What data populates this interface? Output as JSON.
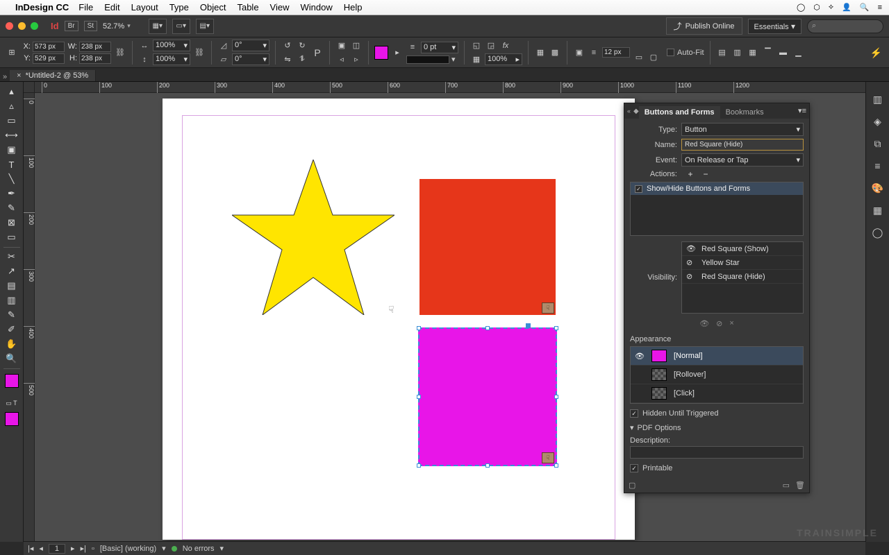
{
  "mac_menu": {
    "app": "InDesign CC",
    "items": [
      "File",
      "Edit",
      "Layout",
      "Type",
      "Object",
      "Table",
      "View",
      "Window",
      "Help"
    ]
  },
  "app_bar": {
    "zoom": "52.7%",
    "publish": "Publish Online",
    "workspace": "Essentials"
  },
  "control": {
    "x": "573 px",
    "y": "529 px",
    "w": "238 px",
    "h": "238 px",
    "scaleX": "100%",
    "scaleY": "100%",
    "rotate": "0°",
    "shear": "0°",
    "stroke": "0 pt",
    "opacity": "100%",
    "gap": "12 px",
    "autofit": "Auto-Fit"
  },
  "doc_tab": "*Untitled-2 @ 53%",
  "ruler_h": [
    0,
    100,
    200,
    300,
    400,
    500,
    600,
    700,
    800,
    900,
    1000,
    1100,
    1200
  ],
  "ruler_v": [
    0,
    100,
    200,
    300,
    400,
    500
  ],
  "panel": {
    "tab_active": "Buttons and Forms",
    "tab_other": "Bookmarks",
    "type_lbl": "Type:",
    "type_val": "Button",
    "name_lbl": "Name:",
    "name_val": "Red Square (Hide)",
    "event_lbl": "Event:",
    "event_val": "On Release or Tap",
    "actions_lbl": "Actions:",
    "action_item": "Show/Hide Buttons and Forms",
    "visibility_lbl": "Visibility:",
    "vis_items": [
      "Red Square (Show)",
      "Yellow Star",
      "Red Square (Hide)"
    ],
    "appearance_lbl": "Appearance",
    "ap_items": [
      "[Normal]",
      "[Rollover]",
      "[Click]"
    ],
    "hidden_chk": "Hidden Until Triggered",
    "pdf_opts": "PDF Options",
    "desc_lbl": "Description:",
    "printable": "Printable"
  },
  "status": {
    "page": "1",
    "preset": "[Basic] (working)",
    "errors": "No errors"
  },
  "watermark": "TRAINSIMPLE"
}
